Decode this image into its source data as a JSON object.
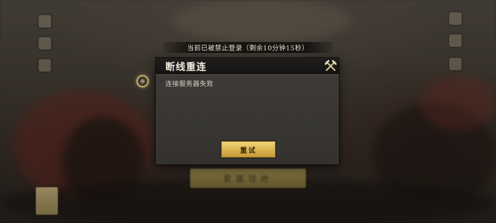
{
  "banner": {
    "text": "当前已被禁止登录（剩余10分钟15秒）"
  },
  "dialog": {
    "title": "断线重连",
    "message": "连接服务器失败",
    "retry_label": "重试",
    "close_icon": "crossed-swords-close-icon"
  },
  "background": {
    "main_button_label": "要塞领地"
  },
  "colors": {
    "retry_gold": "#d9b34f",
    "dialog_bg": "#3a3835",
    "header_bg": "#1a1917",
    "title_text": "#efe9dc"
  }
}
